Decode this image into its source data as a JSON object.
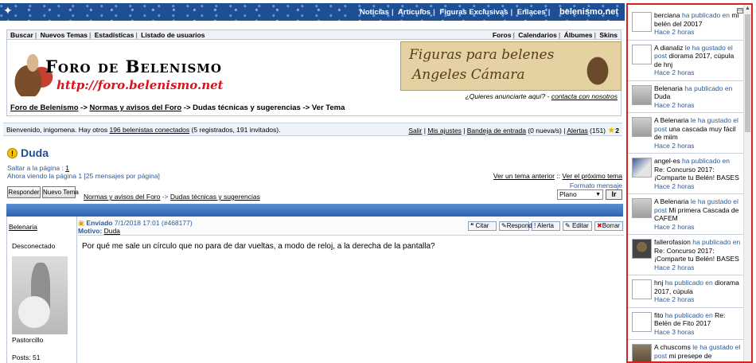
{
  "topnav": {
    "items": [
      "Noticias",
      "Artículos",
      "Figuras Exclusivas",
      "Enlaces"
    ],
    "brand": "belenismo.net"
  },
  "navbar": {
    "left": [
      "Buscar",
      "Nuevos Temas",
      "Estadísticas",
      "Listado de usuarios"
    ],
    "right": [
      "Foros",
      "Calendarios",
      "Álbumes",
      "Skins"
    ]
  },
  "logo": {
    "title": "Foro de Belenismo",
    "url": "http://foro.belenismo.net"
  },
  "banner": {
    "line1": "Figuras para belenes",
    "line2": "Angeles Cámara",
    "ad_question": "¿Quieres anunciarte aquí?",
    "ad_link": "contacta con nosotros"
  },
  "breadcrumb1": {
    "a": "Foro de Belenismo",
    "b": "Normas y avisos del Foro",
    "c": "Dudas técnicas y sugerencias",
    "d": "Ver Tema",
    "arrow": "->"
  },
  "welcome": {
    "prefix": "Bienvenido, inigomena. Hay otros ",
    "online_link": "196 belenistas conectados",
    "suffix": " (5 registrados, 191 invitados).",
    "salir": "Salir",
    "ajustes": "Mis ajustes",
    "bandeja": "Bandeja de entrada",
    "bandeja_count": " (0 nueva/s)",
    "alertas": "Alertas",
    "alertas_count": " (151)",
    "stars": "2"
  },
  "topic": {
    "title": "Duda",
    "jump": "Saltar a la página :",
    "jump_page": "1",
    "viewing": "Ahora viendo la página 1 [25 mensajes por página]",
    "prev": "Ver un tema anterior",
    "sep": "::",
    "next": "Ver el próximo tema",
    "format_label": "Formato mensaje",
    "format_value": "Plano",
    "go": "Ir",
    "reply_btn": "Responder",
    "new_btn": "Nuevo Tema",
    "crumb_a": "Normas y avisos del Foro",
    "crumb_b": "Dudas técnicas y sugerencias"
  },
  "post": {
    "author": "Belenaria",
    "status": "Desconectado",
    "rank": "Pastorcillo",
    "posts": "Posts: 51",
    "sent_label": "Enviado",
    "sent_date": "7/1/2018 17:01 (#468177)",
    "motivo_label": "Motivo:",
    "motivo": "Duda",
    "buttons": [
      "Citar",
      "Responder",
      "Alerta",
      "Editar",
      "Borrar"
    ],
    "body": "Por qué me sale un círculo que no para de dar vueltas, a modo de reloj, a la derecha de la pantalla?"
  },
  "sidebar": {
    "items": [
      {
        "user": "berciana",
        "verb": "ha publicado en",
        "text": "mi belén del 20017",
        "time": "Hace 2 horas",
        "avatar": "blank"
      },
      {
        "user": "dianaliz",
        "verb": "le ha gustado el post",
        "text": "diorama 2017, cúpula de hnj",
        "time": "Hace 2 horas",
        "avatar": "blank",
        "prefix": "A"
      },
      {
        "user": "Belenaria",
        "verb": "ha publicado en",
        "text": "Duda",
        "time": "Hace 2 horas",
        "avatar": "img"
      },
      {
        "user": "Belenaria",
        "verb": "le ha gustado el post",
        "text": "una cascada muy fácil de miim",
        "time": "Hace 2 horas",
        "avatar": "img",
        "prefix": "A"
      },
      {
        "user": "angel-es",
        "verb": "ha publicado en",
        "text": "Re: Concurso 2017: ¡Comparte tu Belén! BASES",
        "time": "Hace 2 horas",
        "avatar": "img2"
      },
      {
        "user": "Belenaria",
        "verb": "le ha gustado el post",
        "text": "Mi primera Cascada de CAFEM",
        "time": "Hace 2 horas",
        "avatar": "img",
        "prefix": "A"
      },
      {
        "user": "fallerofasion",
        "verb": "ha publicado en",
        "text": "Re: Concurso 2017: ¡Comparte tu Belén! BASES",
        "time": "Hace 2 horas",
        "avatar": "img3"
      },
      {
        "user": "hnj",
        "verb": "ha publicado en",
        "text": "diorama 2017, cúpula",
        "time": "Hace 2 horas",
        "avatar": "blank"
      },
      {
        "user": "fito",
        "verb": "ha publicado en",
        "text": "Re: Belén de Fito 2017",
        "time": "Hace 3 horas",
        "avatar": "blank"
      },
      {
        "user": "chuscoms",
        "verb": "le ha gustado el post",
        "text": "mi presepe de",
        "time": "",
        "avatar": "img4",
        "prefix": "A"
      }
    ]
  }
}
